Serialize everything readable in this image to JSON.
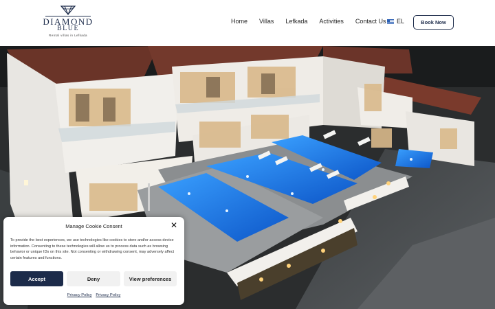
{
  "logo": {
    "brand_line1": "DIAMOND",
    "brand_line2": "BLUE",
    "tagline": "Rental villas in Lefkada"
  },
  "nav": {
    "items": [
      "Home",
      "Villas",
      "Lefkada",
      "Activities",
      "Contact Us"
    ],
    "language": "EL",
    "book_label": "Book Now"
  },
  "cookie": {
    "title": "Manage Cookie Consent",
    "close_icon": "close-icon",
    "text": "To provide the best experiences, we use technologies like cookies to store and/or access device information. Consenting to these technologies will allow us to process data such as browsing behavior or unique IDs on this site. Not consenting or withdrawing consent, may adversely affect certain features and functions.",
    "accept_label": "Accept",
    "deny_label": "Deny",
    "prefs_label": "View preferences",
    "link1": "Privacy Policy",
    "link2": "Privacy Policy"
  },
  "colors": {
    "brand_navy": "#1c2b4a",
    "pool_blue": "#1f7ae0"
  }
}
